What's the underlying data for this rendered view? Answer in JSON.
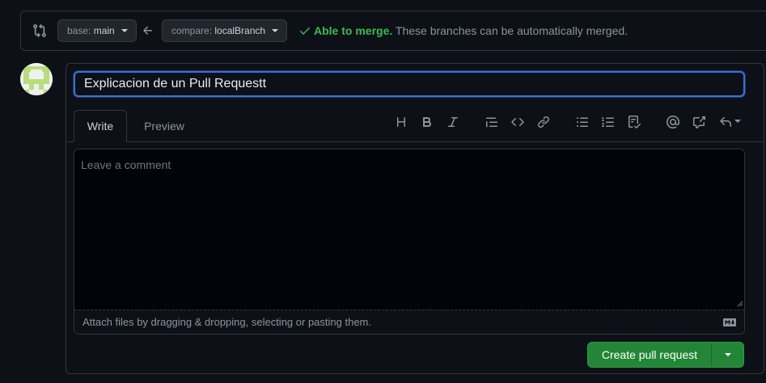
{
  "compare": {
    "base_label": "base:",
    "base_value": "main",
    "compare_label": "compare:",
    "compare_value": "localBranch",
    "merge_ok": "Able to merge.",
    "merge_desc": "These branches can be automatically merged."
  },
  "form": {
    "title_value": "Explicacion de un Pull Requestt",
    "tabs": [
      {
        "label": "Write",
        "active": true
      },
      {
        "label": "Preview",
        "active": false
      }
    ],
    "toolbar": {
      "heading": "H",
      "icons": [
        "heading-icon",
        "bold-icon",
        "italic-icon",
        "quote-icon",
        "code-icon",
        "link-icon",
        "unordered-list-icon",
        "ordered-list-icon",
        "task-list-icon",
        "mention-icon",
        "cross-reference-icon",
        "saved-replies-icon"
      ]
    },
    "comment_placeholder": "Leave a comment",
    "attach_text": "Attach files by dragging & dropping, selecting or pasting them.",
    "submit_label": "Create pull request"
  },
  "colors": {
    "background": "#0d1117",
    "accent_green": "#238636",
    "success_text": "#3fb950",
    "focus_blue": "#3a6fd8"
  }
}
